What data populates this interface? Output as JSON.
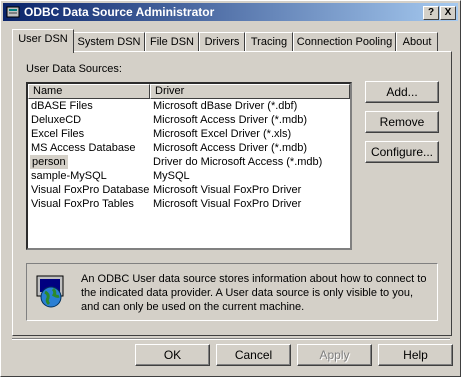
{
  "window": {
    "title": "ODBC Data Source Administrator",
    "help_btn": "?",
    "close_btn": "X"
  },
  "tabs": [
    {
      "label": "User DSN"
    },
    {
      "label": "System DSN"
    },
    {
      "label": "File DSN"
    },
    {
      "label": "Drivers"
    },
    {
      "label": "Tracing"
    },
    {
      "label": "Connection Pooling"
    },
    {
      "label": "About"
    }
  ],
  "list": {
    "section_label": "User Data Sources:",
    "columns": [
      "Name",
      "Driver"
    ],
    "rows": [
      {
        "name": "dBASE Files",
        "driver": "Microsoft dBase Driver (*.dbf)"
      },
      {
        "name": "DeluxeCD",
        "driver": "Microsoft Access Driver (*.mdb)"
      },
      {
        "name": "Excel Files",
        "driver": "Microsoft Excel Driver (*.xls)"
      },
      {
        "name": "MS Access Database",
        "driver": "Microsoft Access Driver (*.mdb)"
      },
      {
        "name": "person",
        "driver": "Driver do Microsoft Access (*.mdb)"
      },
      {
        "name": "sample-MySQL",
        "driver": "MySQL"
      },
      {
        "name": "Visual FoxPro Database",
        "driver": "Microsoft Visual FoxPro Driver"
      },
      {
        "name": "Visual FoxPro Tables",
        "driver": "Microsoft Visual FoxPro Driver"
      }
    ],
    "selected": "person"
  },
  "side_buttons": {
    "add": "Add...",
    "remove": "Remove",
    "configure": "Configure..."
  },
  "info": {
    "text": "An ODBC User data source stores information about how to connect to the indicated data provider.   A User data source is only visible to you, and can only be used on the current machine."
  },
  "footer": {
    "ok": "OK",
    "cancel": "Cancel",
    "apply": "Apply",
    "help": "Help"
  },
  "colors": {
    "titlebar_start": "#0a246a",
    "titlebar_end": "#a6caf0",
    "face": "#d4d0c8",
    "selection": "#d4d0c8"
  }
}
